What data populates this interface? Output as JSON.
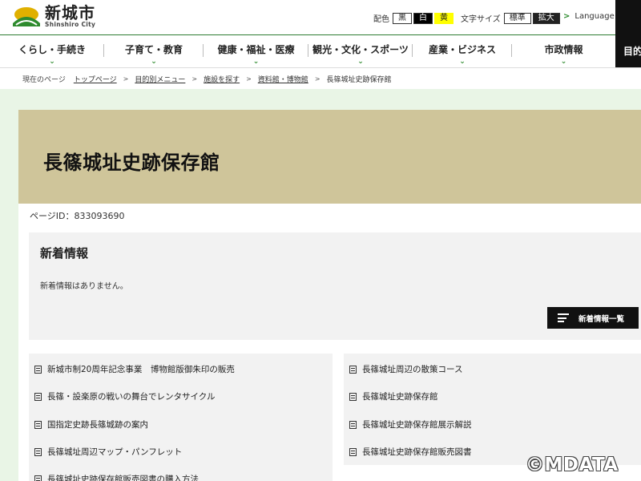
{
  "header": {
    "logo_name": "新城市",
    "logo_sub": "Shinshiro City",
    "color_label": "配色",
    "color_options": [
      "黒",
      "白",
      "黄"
    ],
    "size_label": "文字サイズ",
    "size_options": [
      "標準",
      "拡大"
    ],
    "language_label": "Language",
    "purpose_label": "目的"
  },
  "nav": {
    "items": [
      {
        "label": "くらし・手続き"
      },
      {
        "label": "子育て・教育"
      },
      {
        "label": "健康・福祉・医療"
      },
      {
        "label": "観光・文化・スポーツ"
      },
      {
        "label": "産業・ビジネス"
      },
      {
        "label": "市政情報"
      }
    ]
  },
  "breadcrumb": {
    "here_label": "現在のページ",
    "links": [
      "トップページ",
      "目的別メニュー",
      "施設を探す",
      "資料館・博物館"
    ],
    "current": "長篠城址史跡保存館"
  },
  "page": {
    "title": "長篠城址史跡保存館",
    "page_id": "ページID：833093690"
  },
  "news": {
    "title": "新着情報",
    "empty_text": "新着情報はありません。",
    "list_button": "新着情報一覧"
  },
  "links_left": [
    "新城市制20周年記念事業　博物館版御朱印の販売",
    "長篠・設楽原の戦いの舞台でレンタサイクル",
    "国指定史跡長篠城跡の案内",
    "長篠城址周辺マップ・パンフレット",
    "長篠城址史跡保存館販売図書の購入方法"
  ],
  "links_right": [
    "長篠城址周辺の散策コース",
    "長篠城址史跡保存館",
    "長篠城址史跡保存館展示解説",
    "長篠城址史跡保存館販売図書"
  ],
  "watermark": "©MDATA",
  "colors": {
    "accent_green": "#2e8b2e",
    "banner": "#cfc59a",
    "page_background": "#e9f5e6",
    "highlight_yellow": "#ffff00"
  }
}
